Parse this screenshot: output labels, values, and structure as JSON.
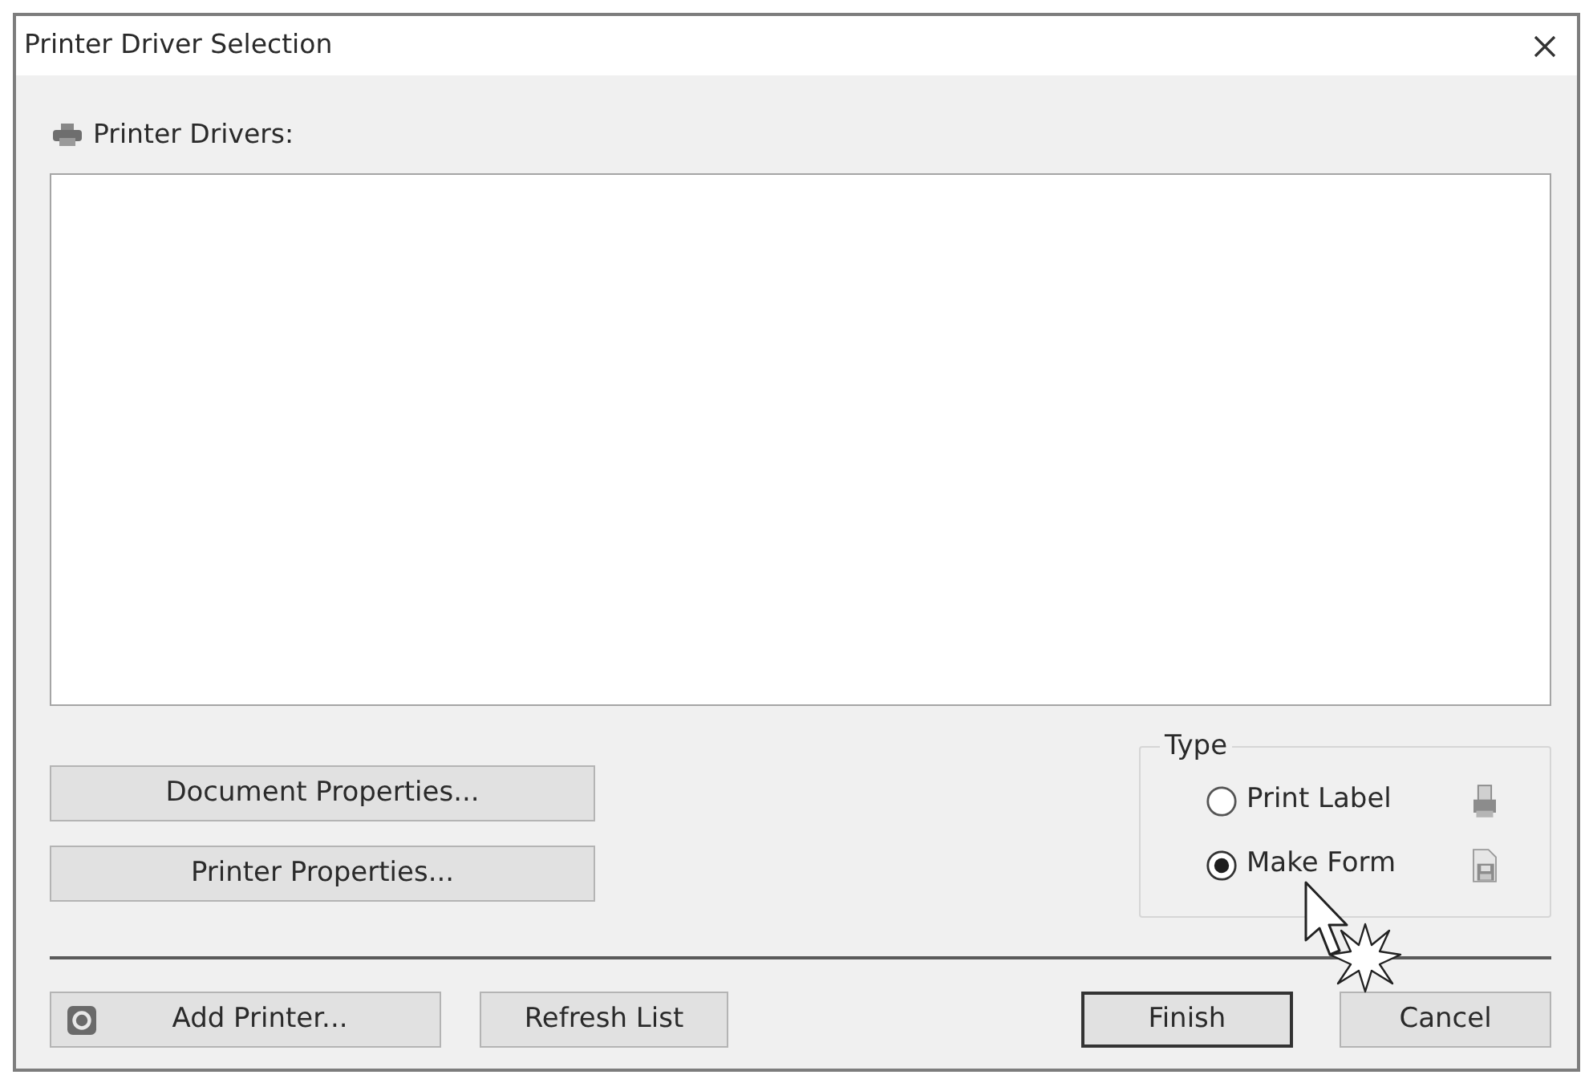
{
  "window": {
    "title": "Printer Driver Selection"
  },
  "drivers": {
    "label": "Printer Drivers:"
  },
  "property_buttons": [
    {
      "label": "Document Properties..."
    },
    {
      "label": "Printer Properties..."
    }
  ],
  "type_group": {
    "legend": "Type",
    "options": [
      {
        "label": "Print Label",
        "selected": false,
        "kind": "printer"
      },
      {
        "label": "Make Form",
        "selected": true,
        "kind": "form"
      }
    ]
  },
  "footer_buttons": [
    {
      "label": "Add Printer...",
      "kind": "add",
      "default": false
    },
    {
      "label": "Refresh List",
      "kind": "plain",
      "default": false
    },
    {
      "label": "Finish",
      "kind": "plain",
      "default": true
    },
    {
      "label": "Cancel",
      "kind": "plain",
      "default": false
    }
  ]
}
